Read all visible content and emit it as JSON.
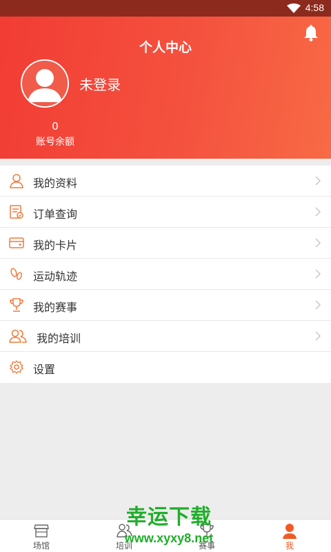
{
  "status_bar": {
    "time": "4:58"
  },
  "header": {
    "title": "个人中心",
    "login_text": "未登录",
    "balance_value": "0",
    "balance_label": "账号余额"
  },
  "menu": {
    "items": [
      {
        "label": "我的资料",
        "icon": "user-profile-icon"
      },
      {
        "label": "订单查询",
        "icon": "order-icon"
      },
      {
        "label": "我的卡片",
        "icon": "card-icon"
      },
      {
        "label": "运动轨迹",
        "icon": "footprint-icon"
      },
      {
        "label": "我的赛事",
        "icon": "trophy-icon"
      },
      {
        "label": "我的培训",
        "icon": "users-icon"
      },
      {
        "label": "设置",
        "icon": "gear-icon"
      }
    ]
  },
  "tabbar": {
    "tabs": [
      {
        "label": "场馆",
        "icon": "venue-icon",
        "active": false
      },
      {
        "label": "培训",
        "icon": "training-icon",
        "active": false
      },
      {
        "label": "赛事",
        "icon": "event-icon",
        "active": false
      },
      {
        "label": "我",
        "icon": "me-icon",
        "active": true
      }
    ]
  },
  "watermark": {
    "line1": "幸运下载",
    "line2": "www.xyxy8.net"
  },
  "colors": {
    "accent": "#f15a24",
    "header_start": "#f23c34",
    "header_end": "#f86a45",
    "watermark": "#1fae2a"
  }
}
